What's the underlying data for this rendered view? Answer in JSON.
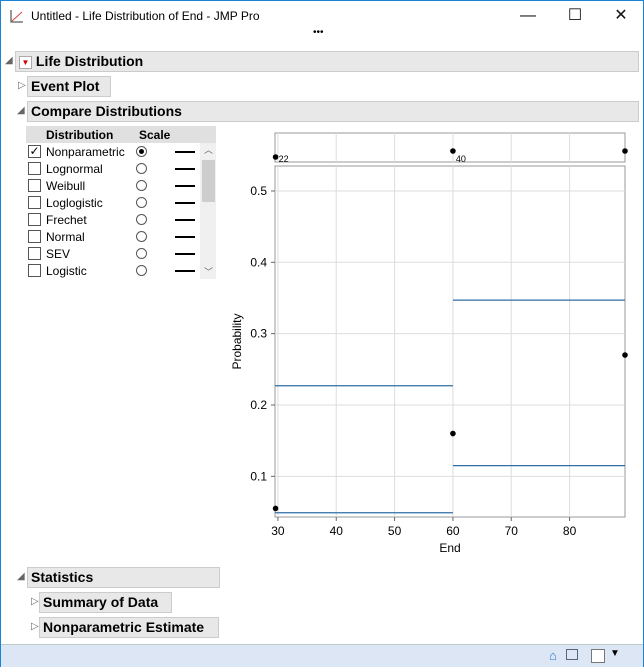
{
  "window": {
    "title": "Untitled - Life Distribution of End - JMP Pro",
    "more": "•••",
    "minimize": "—",
    "maximize": "☐",
    "close": "✕"
  },
  "report": {
    "life_distribution": "Life Distribution",
    "event_plot": "Event Plot",
    "compare": "Compare Distributions",
    "table": {
      "col_distribution": "Distribution",
      "col_scale": "Scale",
      "rows": [
        {
          "label": "Nonparametric",
          "checked": true,
          "scale_selected": true
        },
        {
          "label": "Lognormal",
          "checked": false,
          "scale_selected": false
        },
        {
          "label": "Weibull",
          "checked": false,
          "scale_selected": false
        },
        {
          "label": "Loglogistic",
          "checked": false,
          "scale_selected": false
        },
        {
          "label": "Frechet",
          "checked": false,
          "scale_selected": false
        },
        {
          "label": "Normal",
          "checked": false,
          "scale_selected": false
        },
        {
          "label": "SEV",
          "checked": false,
          "scale_selected": false
        },
        {
          "label": "Logistic",
          "checked": false,
          "scale_selected": false
        }
      ]
    },
    "statistics": "Statistics",
    "summary": "Summary of Data",
    "np_estimate": "Nonparametric Estimate"
  },
  "chart_data": {
    "type": "line",
    "xlabel": "End",
    "ylabel": "Probability",
    "xlim": [
      29.5,
      89.5
    ],
    "ylim": [
      0.043,
      0.535
    ],
    "xticks": [
      "30",
      "40",
      "50",
      "60",
      "70",
      "80"
    ],
    "yticks": [
      "0.1",
      "0.2",
      "0.3",
      "0.4",
      "0.5"
    ],
    "grid": true,
    "estimate_points": [
      {
        "x": 29.6,
        "y": 0.055
      },
      {
        "x": 60,
        "y": 0.16
      },
      {
        "x": 89.5,
        "y": 0.27
      }
    ],
    "lower_band": [
      {
        "x0": 29.5,
        "x1": 60,
        "y": 0.049
      },
      {
        "x0": 60,
        "x1": 89.5,
        "y": 0.115
      }
    ],
    "upper_band": [
      {
        "x0": 29.5,
        "x1": 60,
        "y": 0.227
      },
      {
        "x0": 60,
        "x1": 89.5,
        "y": 0.347
      }
    ],
    "event_strip": {
      "points": [
        {
          "x": 29.6,
          "label": "22"
        },
        {
          "x": 60,
          "label": "40"
        },
        {
          "x": 89.5,
          "label": ""
        }
      ]
    },
    "band_color": "#2e6ea6"
  }
}
